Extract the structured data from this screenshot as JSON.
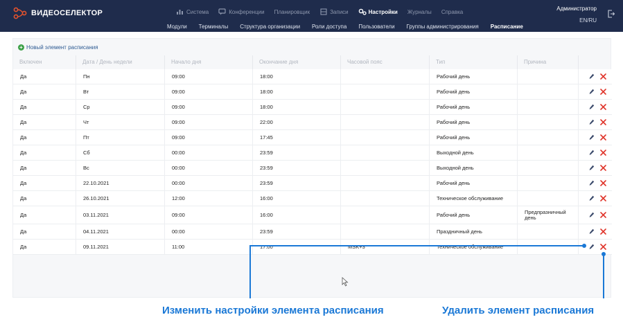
{
  "app": {
    "logo_text": "ВИДЕОСЕЛЕКТОР"
  },
  "main_nav": [
    {
      "label": "Система",
      "icon": "chart-icon"
    },
    {
      "label": "Конференции",
      "icon": "chat-icon"
    },
    {
      "label": "Планировщик",
      "icon": ""
    },
    {
      "label": "Записи",
      "icon": "film-icon"
    },
    {
      "label": "Настройки",
      "icon": "gears-icon",
      "active": true
    },
    {
      "label": "Журналы",
      "icon": ""
    },
    {
      "label": "Справка",
      "icon": ""
    }
  ],
  "sub_nav": [
    {
      "label": "Модули"
    },
    {
      "label": "Терминалы"
    },
    {
      "label": "Структура организации"
    },
    {
      "label": "Роли доступа"
    },
    {
      "label": "Пользователи"
    },
    {
      "label": "Группы администрирования"
    },
    {
      "label": "Расписание",
      "active": true
    }
  ],
  "user": {
    "name": "Администратор",
    "lang": "EN/RU"
  },
  "toolbar": {
    "add_label": "Новый элемент расписания"
  },
  "table": {
    "columns": [
      "Включен",
      "Дата / День недели",
      "Начало дня",
      "Окончание дня",
      "Часовой пояс",
      "Тип",
      "Причина"
    ],
    "rows": [
      {
        "enabled": "Да",
        "date": "Пн",
        "start": "09:00",
        "end": "18:00",
        "tz": "",
        "type": "Рабочий день",
        "reason": ""
      },
      {
        "enabled": "Да",
        "date": "Вт",
        "start": "09:00",
        "end": "18:00",
        "tz": "",
        "type": "Рабочий день",
        "reason": ""
      },
      {
        "enabled": "Да",
        "date": "Ср",
        "start": "09:00",
        "end": "18:00",
        "tz": "",
        "type": "Рабочий день",
        "reason": ""
      },
      {
        "enabled": "Да",
        "date": "Чт",
        "start": "09:00",
        "end": "22:00",
        "tz": "",
        "type": "Рабочий день",
        "reason": ""
      },
      {
        "enabled": "Да",
        "date": "Пт",
        "start": "09:00",
        "end": "17:45",
        "tz": "",
        "type": "Рабочий день",
        "reason": ""
      },
      {
        "enabled": "Да",
        "date": "Сб",
        "start": "00:00",
        "end": "23:59",
        "tz": "",
        "type": "Выходной день",
        "reason": ""
      },
      {
        "enabled": "Да",
        "date": "Вс",
        "start": "00:00",
        "end": "23:59",
        "tz": "",
        "type": "Выходной день",
        "reason": ""
      },
      {
        "enabled": "Да",
        "date": "22.10.2021",
        "start": "00:00",
        "end": "23:59",
        "tz": "",
        "type": "Рабочий день",
        "reason": ""
      },
      {
        "enabled": "Да",
        "date": "26.10.2021",
        "start": "12:00",
        "end": "16:00",
        "tz": "",
        "type": "Техническое обслуживание",
        "reason": ""
      },
      {
        "enabled": "Да",
        "date": "03.11.2021",
        "start": "09:00",
        "end": "16:00",
        "tz": "",
        "type": "Рабочий день",
        "reason": "Предпразничный день"
      },
      {
        "enabled": "Да",
        "date": "04.11.2021",
        "start": "00:00",
        "end": "23:59",
        "tz": "",
        "type": "Праздничный день",
        "reason": ""
      },
      {
        "enabled": "Да",
        "date": "09.11.2021",
        "start": "11:00",
        "end": "17:00",
        "tz": "MSK+3",
        "type": "Техническое обслуживание",
        "reason": ""
      }
    ]
  },
  "annotations": {
    "edit": "Изменить настройки элемента расписания",
    "delete": "Удалить элемент расписания"
  },
  "colors": {
    "header_bg": "#1f2c4c",
    "accent_blue": "#1a78d6",
    "delete_red": "#e0352b",
    "add_green": "#3fa24a"
  }
}
